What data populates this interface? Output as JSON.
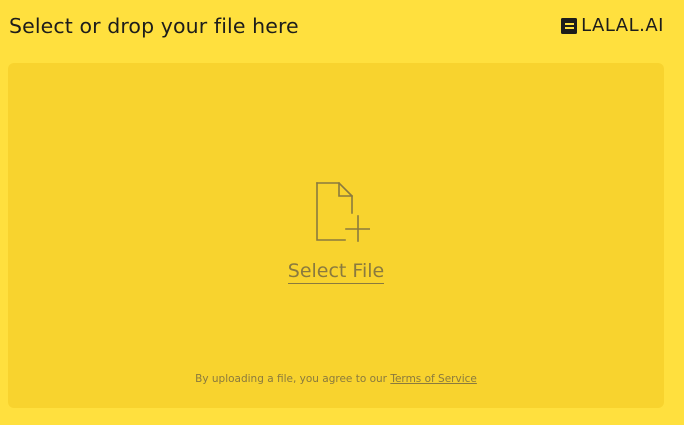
{
  "header": {
    "title": "Select or drop your file here",
    "brand": "LALAL.AI"
  },
  "dropzone": {
    "icon": "file-plus-icon",
    "select_label": "Select File",
    "terms_prefix": "By uploading a file, you agree to our ",
    "terms_link": "Terms of Service"
  },
  "colors": {
    "background": "#FFE03E",
    "dropzone": "#F8D32E",
    "text": "#1d1d1b",
    "muted": "#8a7a3e"
  }
}
